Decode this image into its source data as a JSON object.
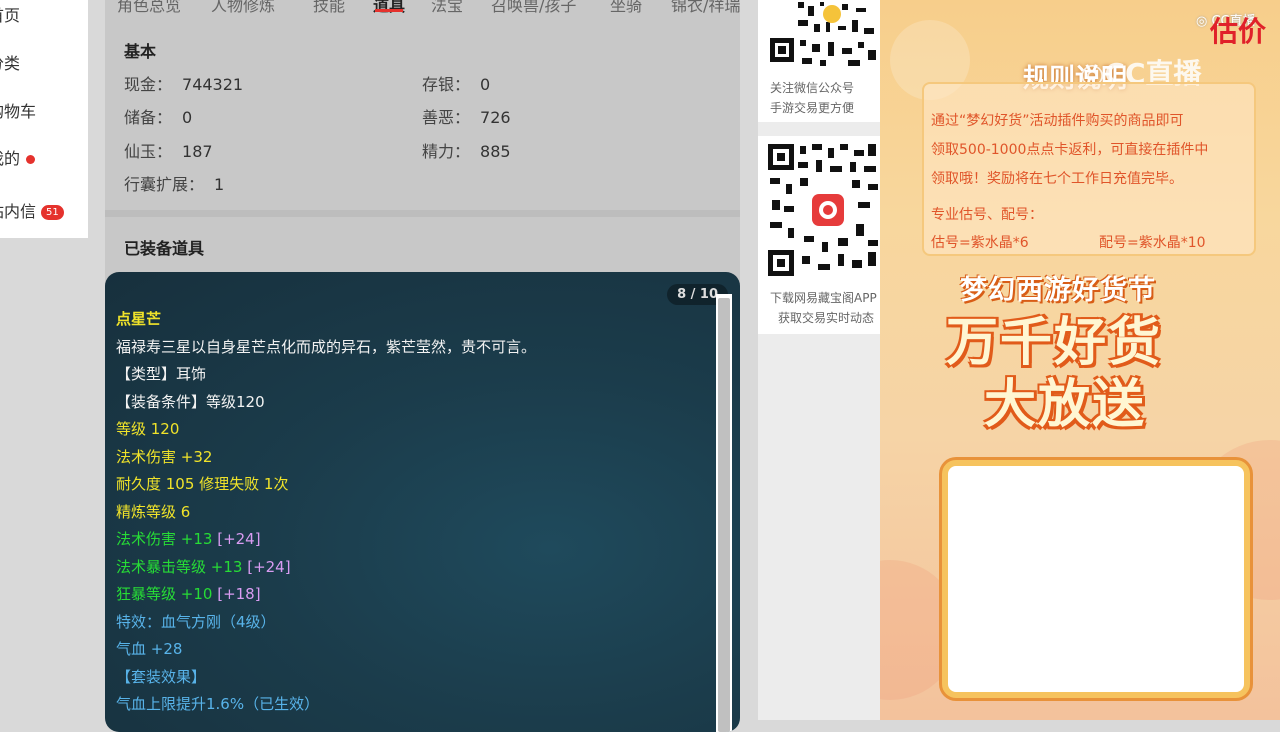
{
  "sidebar": {
    "items": [
      {
        "label": "首页"
      },
      {
        "label": "分类"
      },
      {
        "label": "购物车"
      },
      {
        "label": "我的"
      },
      {
        "label": "站内信",
        "badge": "51"
      }
    ]
  },
  "tabs": [
    "角色总览",
    "人物修炼",
    "技能",
    "道具",
    "法宝",
    "召唤兽/孩子",
    "坐骑",
    "锦衣/祥瑞"
  ],
  "basic": {
    "title": "基本",
    "left": [
      {
        "k": "现金：",
        "v": "744321"
      },
      {
        "k": "储备：",
        "v": "0"
      },
      {
        "k": "仙玉：",
        "v": "187"
      },
      {
        "k": "行囊扩展：",
        "v": "1"
      }
    ],
    "right": [
      {
        "k": "存银：",
        "v": "0"
      },
      {
        "k": "善恶：",
        "v": "726"
      },
      {
        "k": "精力：",
        "v": "885"
      }
    ]
  },
  "equipped_title": "已装备道具",
  "tooltip": {
    "pager": "8 / 10",
    "lines": [
      {
        "t": "点星芒",
        "c": "yellow"
      },
      {
        "t": "福禄寿三星以自身星芒点化而成的异石，紫芒莹然，贵不可言。",
        "c": "white"
      },
      {
        "t": "【类型】耳饰",
        "c": "white"
      },
      {
        "t": "【装备条件】等级120",
        "c": "white"
      },
      {
        "t": "等级 120",
        "c": "yellow"
      },
      {
        "t": "法术伤害 +32",
        "c": "yellow"
      },
      {
        "t": "耐久度 105 修理失败 1次",
        "c": "yellow"
      },
      {
        "t": "精炼等级 6",
        "c": "yellow"
      },
      {
        "t": "法术伤害 +13",
        "c": "green",
        "extra": "[+24]"
      },
      {
        "t": "法术暴击等级 +13",
        "c": "green",
        "extra": "[+24]"
      },
      {
        "t": "狂暴等级 +10",
        "c": "green",
        "extra": "[+18]"
      },
      {
        "t": "特效：血气方刚（4级）",
        "c": "blue"
      },
      {
        "t": "气血 +28",
        "c": "blue"
      },
      {
        "t": "【套装效果】",
        "c": "blue"
      },
      {
        "t": "气血上限提升1.6%（已生效）",
        "c": "blue"
      }
    ]
  },
  "qr": {
    "card1": [
      "关注微信公众号",
      "手游交易更方便"
    ],
    "card2": [
      "下载网易藏宝阁APP",
      "获取交易实时动态"
    ]
  },
  "ad": {
    "watermark_small": "CC直播",
    "price_partial": "估价",
    "title": "规则说明",
    "watermark_big": "CC直播",
    "notice": [
      "通过“梦幻好货”活动插件购买的商品即可",
      "领取500-1000点点卡返利，可直接在插件中",
      "领取哦！奖励将在七个工作日充值完毕。",
      "专业估号、配号：",
      "估号=紫水晶*6"
    ],
    "notice_right": "配号=紫水晶*10",
    "promo_line1": "梦幻西游好货节",
    "promo_line2": "万千好货",
    "promo_line3": "大放送"
  }
}
